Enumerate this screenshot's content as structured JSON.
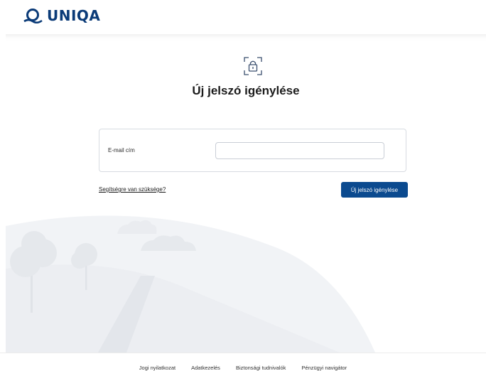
{
  "brand": {
    "name": "UNIQA",
    "color": "#0b3b78"
  },
  "page": {
    "title": "Új jelszó igénylése"
  },
  "form": {
    "email_label": "E-mail cím",
    "email_value": "",
    "email_placeholder": ""
  },
  "help_link": "Segítségre van szüksége?",
  "submit_label": "Új jelszó igénylése",
  "footer": {
    "links": [
      "Jogi nyilatkozat",
      "Adatkezelés",
      "Biztonsági tudnivalók",
      "Pénzügyi navigátor"
    ]
  },
  "colors": {
    "primary": "#0b4a8f",
    "illustration": "#eef0f4"
  },
  "icons": {
    "lock": "lock-icon",
    "logo": "uniqa-logo-icon"
  }
}
